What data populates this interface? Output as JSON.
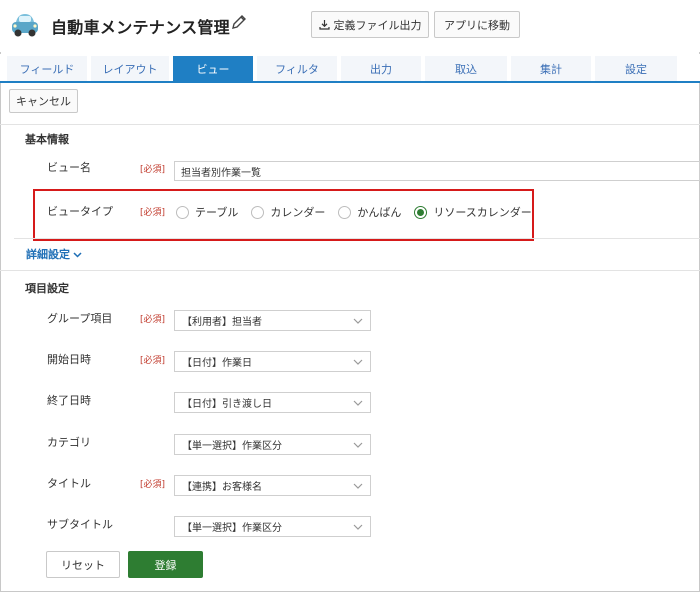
{
  "header": {
    "title": "自動車メンテナンス管理",
    "export_label": "定義ファイル出力",
    "app_label": "アプリに移動"
  },
  "tabs": [
    {
      "label": "フィールド"
    },
    {
      "label": "レイアウト"
    },
    {
      "label": "ビュー"
    },
    {
      "label": "フィルタ"
    },
    {
      "label": "出力"
    },
    {
      "label": "取込"
    },
    {
      "label": "集計"
    },
    {
      "label": "設定"
    }
  ],
  "active_tab": "ビュー",
  "cancel_label": "キャンセル",
  "basic_info": {
    "title": "基本情報",
    "required_label": "[必須]",
    "view_name": {
      "label": "ビュー名",
      "value": "担当者別作業一覧"
    },
    "view_type": {
      "label": "ビュータイプ",
      "options": [
        "テーブル",
        "カレンダー",
        "かんばん",
        "リソースカレンダー"
      ],
      "selected": "リソースカレンダー"
    },
    "advanced_label": "詳細設定"
  },
  "item_settings": {
    "title": "項目設定",
    "required_label": "[必須]",
    "fields": [
      {
        "label": "グループ項目",
        "required": true,
        "value": "【利用者】担当者"
      },
      {
        "label": "開始日時",
        "required": true,
        "value": "【日付】作業日"
      },
      {
        "label": "終了日時",
        "required": false,
        "value": "【日付】引き渡し日"
      },
      {
        "label": "カテゴリ",
        "required": false,
        "value": "【単一選択】作業区分"
      },
      {
        "label": "タイトル",
        "required": true,
        "value": "【連携】お客様名"
      },
      {
        "label": "サブタイトル",
        "required": false,
        "value": "【単一選択】作業区分"
      }
    ]
  },
  "footer": {
    "reset_label": "リセット",
    "submit_label": "登録"
  },
  "colors": {
    "accent": "#1f7fc4",
    "tab_inactive_bg": "#f3f6fa",
    "tab_inactive_text": "#3b6fb6",
    "submit_green": "#2e7d32",
    "required_red": "#c0392b",
    "highlight_red": "#d61a1a"
  },
  "icons": {
    "app": "car-icon",
    "edit": "pencil-icon",
    "export": "download-icon",
    "advanced": "chevron-down-icon",
    "select": "chevron-down-icon"
  }
}
